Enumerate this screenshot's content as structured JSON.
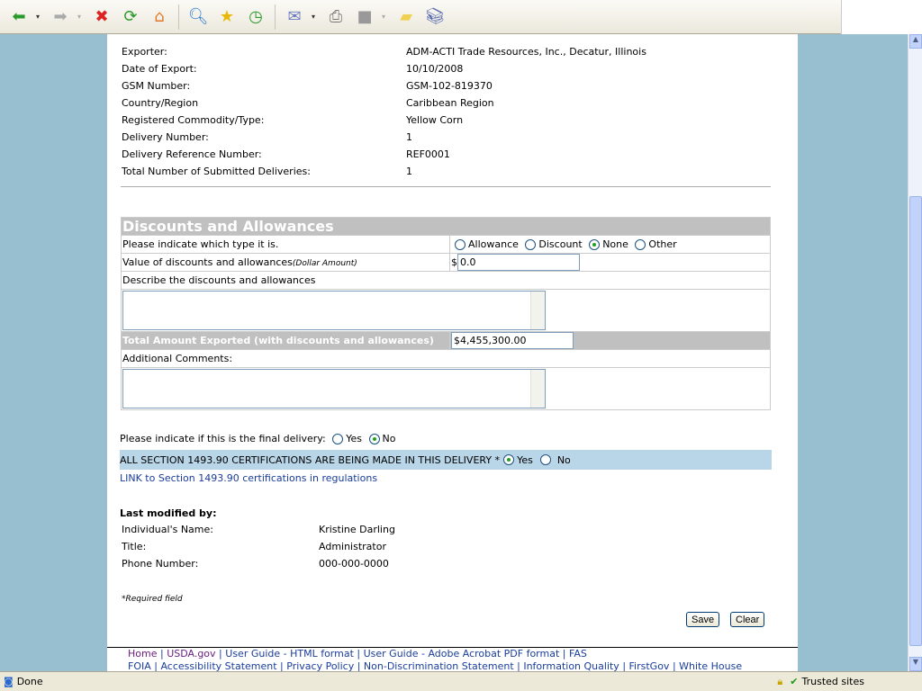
{
  "toolbar": {
    "icons": [
      "back-icon",
      "forward-icon",
      "stop-icon",
      "refresh-icon",
      "home-icon",
      "search-icon",
      "favorites-icon",
      "history-icon",
      "mail-icon",
      "print-icon",
      "edit-icon",
      "notes-icon",
      "research-icon"
    ]
  },
  "export_info": [
    {
      "label": "Exporter:",
      "value": "ADM-ACTI Trade Resources, Inc., Decatur, Illinois"
    },
    {
      "label": "Date of Export:",
      "value": "10/10/2008"
    },
    {
      "label": "GSM Number:",
      "value": "GSM-102-819370"
    },
    {
      "label": "Country/Region",
      "value": "Caribbean Region"
    },
    {
      "label": "Registered Commodity/Type:",
      "value": "Yellow Corn"
    },
    {
      "label": "Delivery Number:",
      "value": "1"
    },
    {
      "label": "Delivery Reference Number:",
      "value": "REF0001"
    },
    {
      "label": "Total Number of Submitted Deliveries:",
      "value": "1"
    }
  ],
  "discounts": {
    "title": "Discounts and Allowances",
    "type_label": "Please indicate which type it is.",
    "type_options": [
      "Allowance",
      "Discount",
      "None",
      "Other"
    ],
    "type_selected": "None",
    "value_label": "Value of discounts and allowances",
    "value_hint": "(Dollar Amount)",
    "currency": "$",
    "value": "0.0",
    "describe_label": "Describe the discounts and allowances",
    "describe_value": "",
    "total_label": "Total Amount Exported (with discounts and allowances)",
    "total_value": "$4,455,300.00",
    "comments_label": "Additional Comments:",
    "comments_value": ""
  },
  "final_delivery": {
    "label": "Please indicate if this is the final delivery:",
    "yes": "Yes",
    "no": "No",
    "selected": "No"
  },
  "certification": {
    "label": "ALL SECTION 1493.90 CERTIFICATIONS ARE BEING MADE IN THIS DELIVERY *",
    "yes": "Yes",
    "no": "No",
    "selected": "Yes"
  },
  "link_text": "LINK to Section 1493.90 certifications in regulations",
  "last_modified": {
    "heading": "Last modified by:",
    "rows": [
      {
        "label": "Individual's Name:",
        "value": "Kristine Darling"
      },
      {
        "label": "Title:",
        "value": "Administrator"
      },
      {
        "label": "Phone Number:",
        "value": "000-000-0000"
      }
    ]
  },
  "required_note": "*Required field",
  "buttons": {
    "save": "Save",
    "clear": "Clear"
  },
  "footer": {
    "line1": [
      "Home",
      "USDA.gov",
      "User Guide - HTML format",
      "User Guide - Adobe Acrobat PDF format",
      "FAS"
    ],
    "line2": [
      "FOIA",
      "Accessibility Statement",
      "Privacy Policy",
      "Non-Discrimination Statement",
      "Information Quality",
      "FirstGov",
      "White House"
    ]
  },
  "status": {
    "text": "Done",
    "zone": "Trusted sites"
  }
}
